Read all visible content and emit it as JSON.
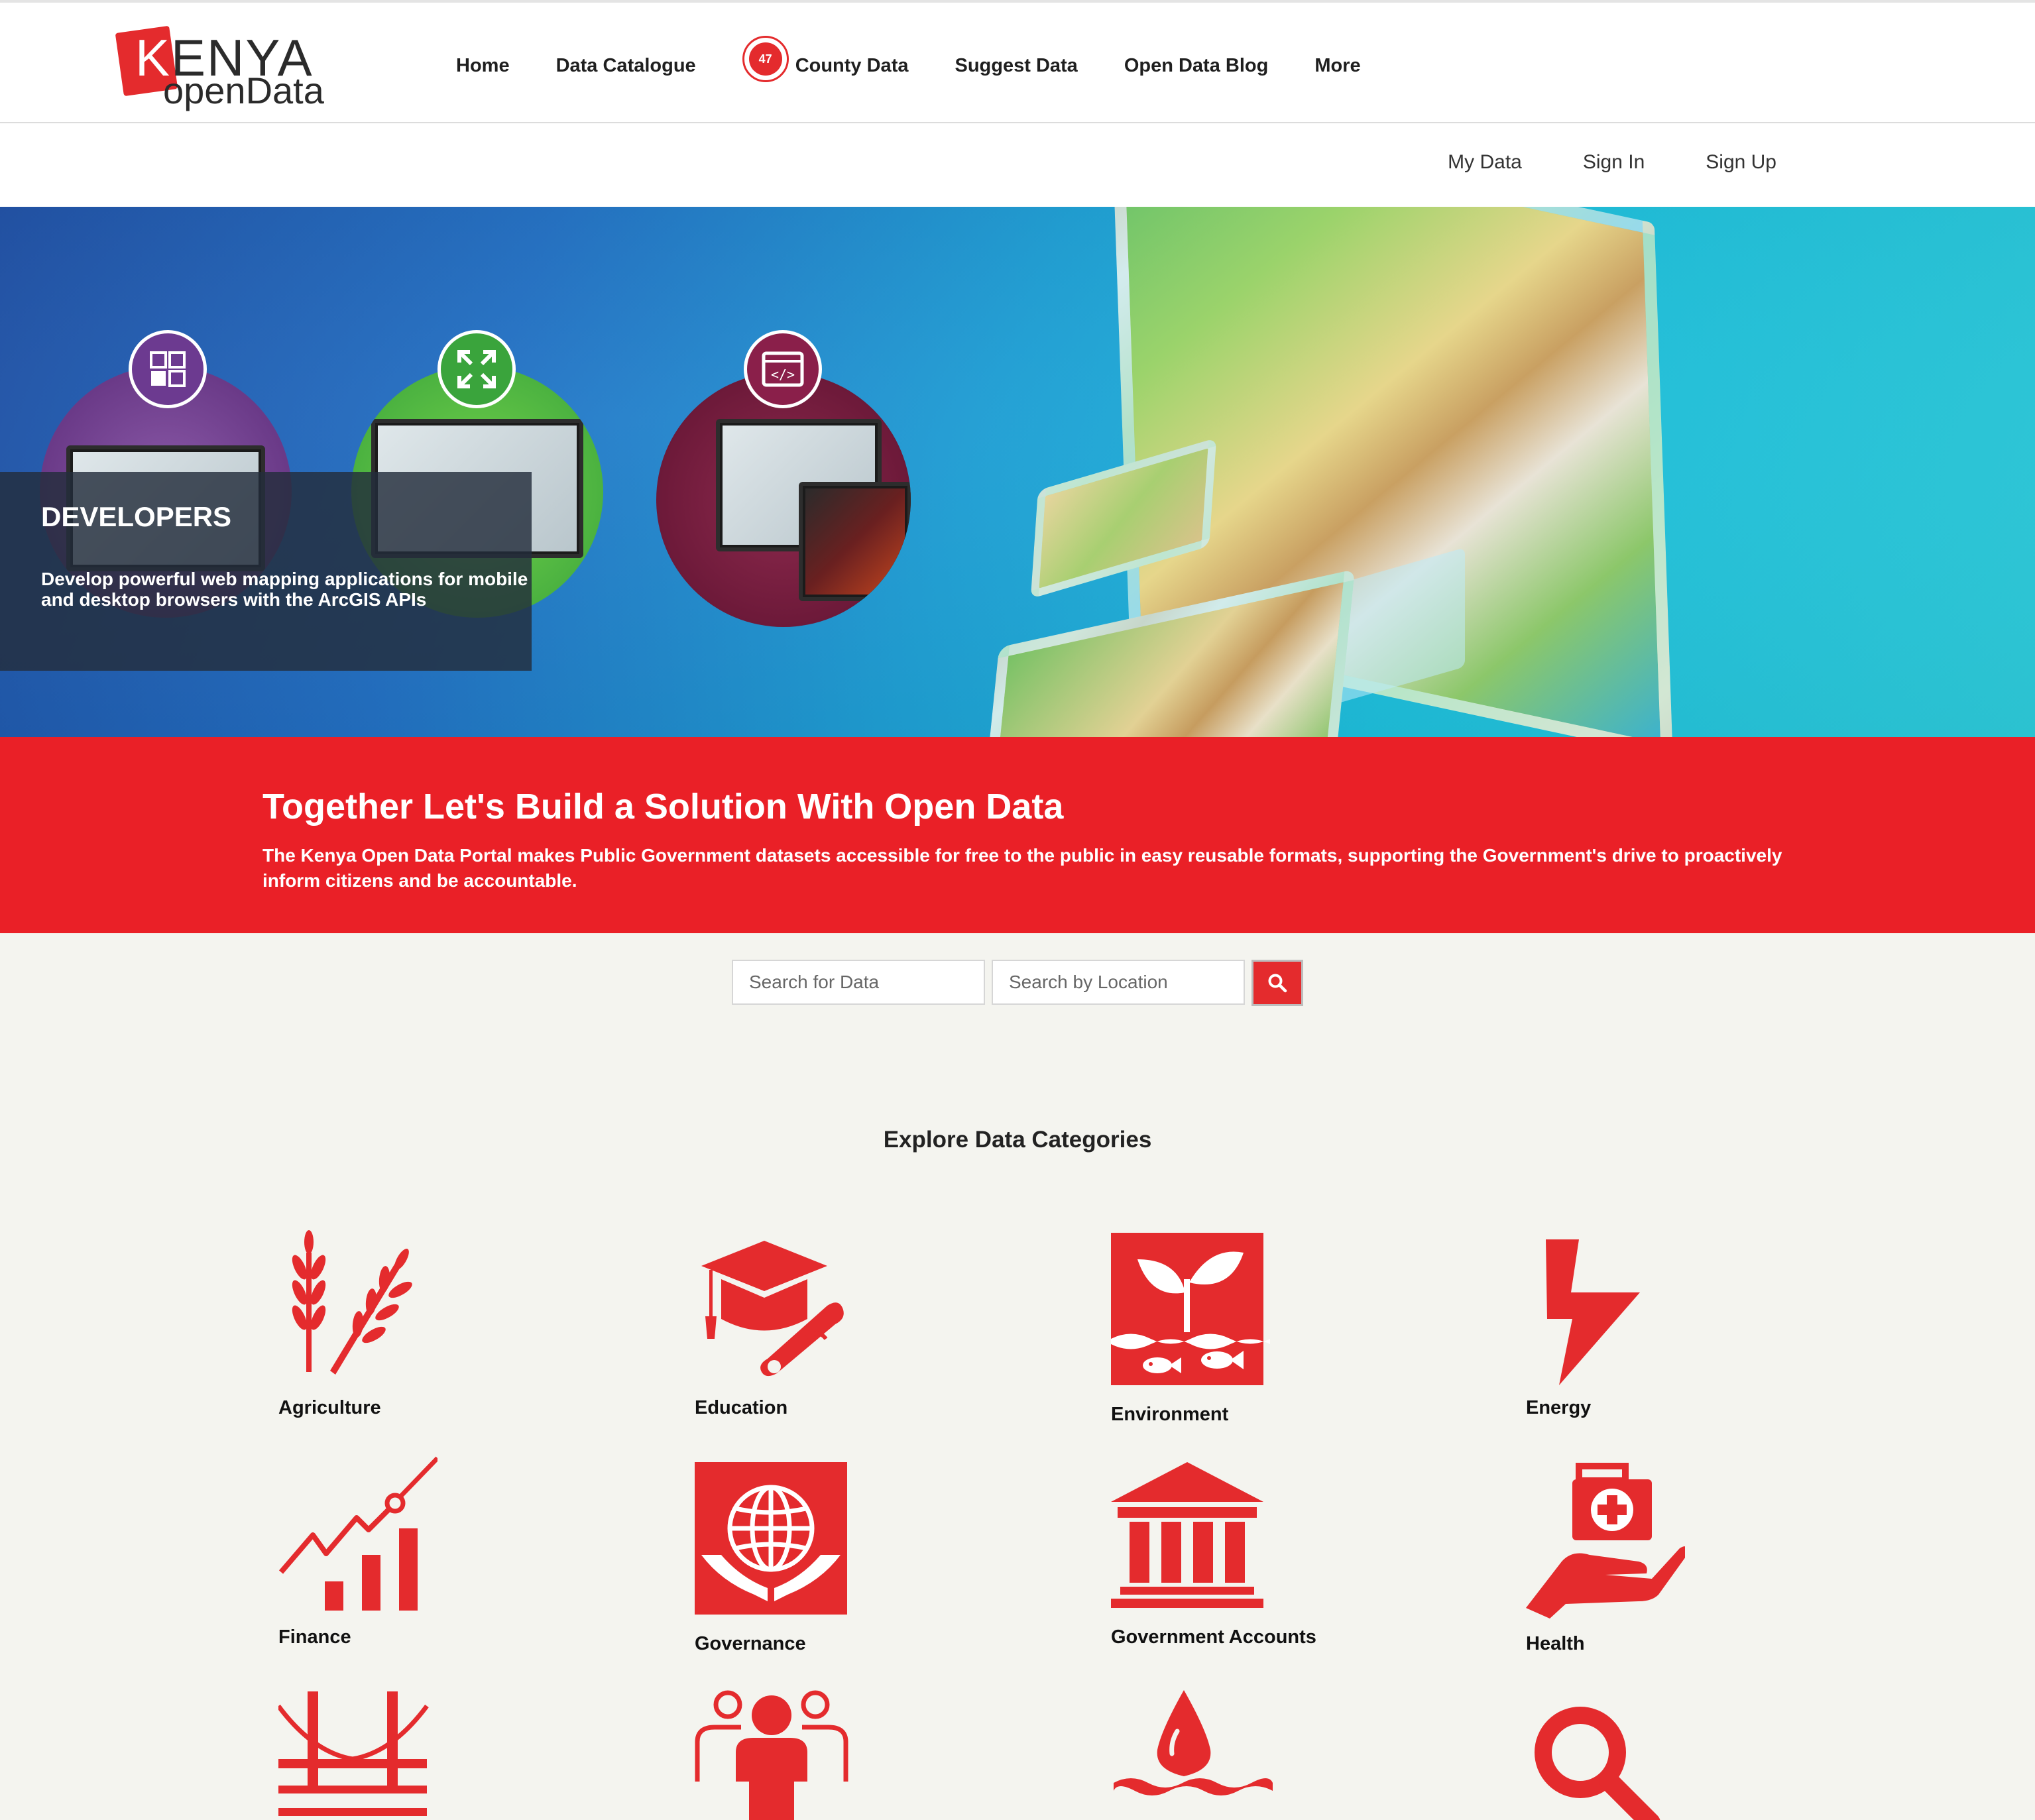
{
  "logo": {
    "kenya": "KENYA",
    "open_data": "openData"
  },
  "nav": {
    "items": [
      {
        "label": "Home"
      },
      {
        "label": "Data Catalogue"
      },
      {
        "label": "County Data",
        "badge": "47"
      },
      {
        "label": "Suggest Data"
      },
      {
        "label": "Open Data Blog"
      },
      {
        "label": "More"
      }
    ]
  },
  "subnav": {
    "items": [
      "My Data",
      "Sign In",
      "Sign Up"
    ]
  },
  "hero": {
    "title": "DEVELOPERS",
    "description": "Develop powerful web mapping applications for mobile and desktop browsers with the ArcGIS APIs"
  },
  "banner": {
    "title": "Together Let's Build a Solution With Open Data",
    "text": "The Kenya Open Data Portal makes Public Government datasets accessible for free to the public in easy reusable formats, supporting the Government's drive to proactively inform citizens and be accountable."
  },
  "search": {
    "data_placeholder": "Search for Data",
    "location_placeholder": "Search by Location"
  },
  "categories": {
    "title": "Explore Data Categories",
    "items": [
      {
        "label": "Agriculture",
        "icon": "wheat-icon"
      },
      {
        "label": "Education",
        "icon": "graduation-cap-icon"
      },
      {
        "label": "Environment",
        "icon": "plant-fish-icon"
      },
      {
        "label": "Energy",
        "icon": "lightning-icon"
      },
      {
        "label": "Finance",
        "icon": "growth-chart-icon"
      },
      {
        "label": "Governance",
        "icon": "globe-hands-icon"
      },
      {
        "label": "Government Accounts",
        "icon": "government-building-icon"
      },
      {
        "label": "Health",
        "icon": "medical-kit-hand-icon"
      },
      {
        "label": "",
        "icon": "bridge-icon"
      },
      {
        "label": "",
        "icon": "people-icon"
      },
      {
        "label": "",
        "icon": "water-drop-icon"
      },
      {
        "label": "",
        "icon": "magnifier-icon"
      }
    ]
  },
  "colors": {
    "brand_red": "#ea2027",
    "icon_red": "#e42b2d",
    "background": "#f4f4ef"
  }
}
